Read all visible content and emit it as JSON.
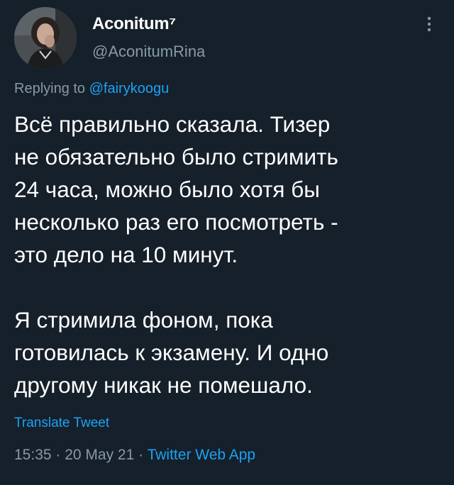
{
  "author": {
    "display_name": "Aconitum⁷",
    "handle": "@AconitumRina"
  },
  "reply": {
    "prefix": "Replying to ",
    "mention": "@fairykoogu"
  },
  "tweet": {
    "paragraphs": [
      [
        "Всё правильно сказала. Тизер",
        "не обязательно было стримить",
        "24 часа, можно было хотя бы",
        "несколько раз его посмотреть -",
        "это дело на 10 минут."
      ],
      [
        "Я стримила фоном, пока",
        "готовилась к экзамену. И одно",
        "другому никак не помешало."
      ]
    ]
  },
  "translate_label": "Translate Tweet",
  "meta": {
    "time": "15:35",
    "separator": " · ",
    "date": "20 May 21",
    "source": "Twitter Web App"
  },
  "icons": {
    "more": "more-vertical-icon",
    "avatar": "profile-photo"
  },
  "colors": {
    "background": "#15202b",
    "secondary_text": "#8899a6",
    "accent": "#1da1f2"
  }
}
